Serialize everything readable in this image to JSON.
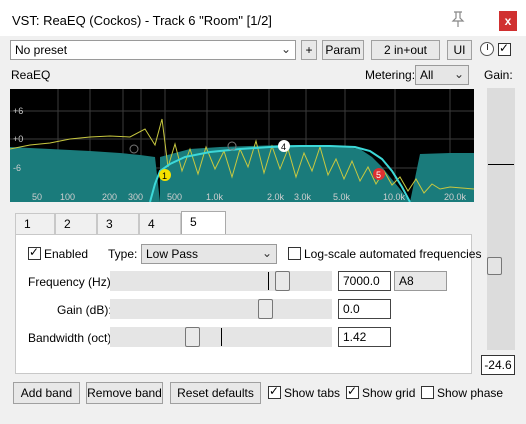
{
  "window": {
    "title": "VST: ReaEQ (Cockos) - Track 6 \"Room\" [1/2]",
    "close_glyph": "x"
  },
  "toolbar": {
    "preset": "No preset",
    "plus_label": "+",
    "param_label": "Param",
    "io_label": "2 in+out",
    "ui_label": "UI",
    "bypass_checked": true
  },
  "plugin_name": "ReaEQ",
  "metering": {
    "label": "Metering:",
    "value": "All"
  },
  "gain": {
    "label": "Gain:",
    "value": "-24.6"
  },
  "graph": {
    "db_labels": [
      "+6",
      "+0",
      "-6"
    ],
    "freq_labels": [
      "50",
      "100",
      "200",
      "300",
      "500",
      "1.0k",
      "2.0k",
      "3.0k",
      "5.0k",
      "10.0k",
      "20.0k"
    ],
    "band_markers": [
      {
        "label": "1",
        "color": "#f5e200"
      },
      {
        "label": "4",
        "color": "#ffffff"
      },
      {
        "label": "5",
        "color": "#e03030"
      }
    ],
    "colors": {
      "background": "#000000",
      "fill": "#1a7b7b",
      "curve": "#3cd8d8",
      "spectrum": "#c8c840"
    }
  },
  "tabs": [
    "1",
    "2",
    "3",
    "4",
    "5"
  ],
  "active_tab": "5",
  "band": {
    "enabled_label": "Enabled",
    "enabled": true,
    "type_label": "Type:",
    "type_value": "Low Pass",
    "logscale_label": "Log-scale automated frequencies",
    "logscale": false,
    "frequency_label": "Frequency (Hz):",
    "frequency_value": "7000.0",
    "note_value": "A8",
    "gain_label": "Gain (dB):",
    "gain_value": "0.0",
    "bandwidth_label": "Bandwidth (oct):",
    "bandwidth_value": "1.42"
  },
  "bottom": {
    "add_band": "Add band",
    "remove_band": "Remove band",
    "reset_defaults": "Reset defaults",
    "show_tabs": "Show tabs",
    "show_grid": "Show grid",
    "show_phase": "Show phase",
    "show_tabs_checked": true,
    "show_grid_checked": true,
    "show_phase_checked": false
  }
}
